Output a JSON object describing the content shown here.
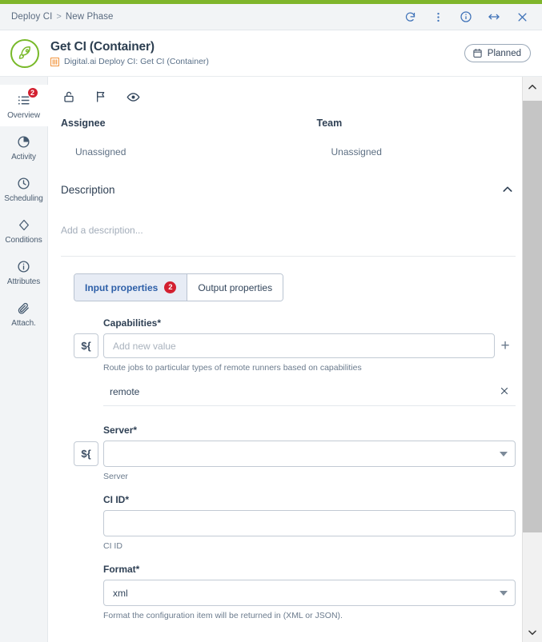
{
  "theme": {
    "accent_green": "#7fb52b",
    "badge_red": "#d32030",
    "link_blue": "#3f72b8",
    "tab_active_bg": "#e7ecf5",
    "tab_active_text": "#2d5fa8",
    "sidebar_bg": "#f2f4f6",
    "subtitle_icon_orange": "#f2953e"
  },
  "breadcrumb": {
    "root": "Deploy CI",
    "separator": ">",
    "current": "New Phase"
  },
  "window_actions": [
    {
      "name": "refresh-icon",
      "label": "Refresh"
    },
    {
      "name": "more-menu-icon",
      "label": "More options"
    },
    {
      "name": "info-icon",
      "label": "Info"
    },
    {
      "name": "expand-icon",
      "label": "Expand"
    },
    {
      "name": "close-icon",
      "label": "Close"
    }
  ],
  "header": {
    "logo_icon": "rocket-icon",
    "title": "Get CI (Container)",
    "subtitle_icon": "task-type-icon",
    "subtitle": "Digital.ai Deploy CI: Get CI (Container)",
    "status_icon": "calendar-icon",
    "status": "Planned"
  },
  "sidebar": {
    "items": [
      {
        "label": "Overview",
        "icon": "list-icon",
        "badge": "2",
        "active": true
      },
      {
        "label": "Activity",
        "icon": "pie-chart-icon",
        "badge": null,
        "active": false
      },
      {
        "label": "Scheduling",
        "icon": "clock-icon",
        "badge": null,
        "active": false
      },
      {
        "label": "Conditions",
        "icon": "diamond-icon",
        "badge": null,
        "active": false
      },
      {
        "label": "Attributes",
        "icon": "info-icon",
        "badge": null,
        "active": false
      },
      {
        "label": "Attach.",
        "icon": "paperclip-icon",
        "badge": null,
        "active": false
      }
    ]
  },
  "toolbar": [
    {
      "name": "unlock-icon",
      "label": "Unlock"
    },
    {
      "name": "flag-icon",
      "label": "Flag"
    },
    {
      "name": "eye-icon",
      "label": "Watch"
    }
  ],
  "assignment": {
    "assignee_label": "Assignee",
    "assignee_value": "Unassigned",
    "team_label": "Team",
    "team_value": "Unassigned"
  },
  "description": {
    "title": "Description",
    "collapse_icon": "chevron-up-icon",
    "placeholder": "Add a description..."
  },
  "tabs": [
    {
      "label": "Input properties",
      "badge": "2",
      "active": true
    },
    {
      "label": "Output properties",
      "badge": null,
      "active": false
    }
  ],
  "properties": {
    "capabilities": {
      "label": "Capabilities",
      "required": "*",
      "expr_button": "${",
      "input_value": "",
      "input_placeholder": "Add new value",
      "add_button": "+",
      "helper": "Route jobs to particular types of remote runners based on capabilities",
      "values": [
        {
          "text": "remote",
          "remove_icon": "close-icon"
        }
      ]
    },
    "server": {
      "label": "Server",
      "required": "*",
      "expr_button": "${",
      "selected": "",
      "helper": "Server"
    },
    "ci_id": {
      "label": "CI ID",
      "required": "*",
      "value": "",
      "helper": "CI ID"
    },
    "format": {
      "label": "Format",
      "required": "*",
      "selected": "xml",
      "helper": "Format the configuration item will be returned in (XML or JSON)."
    }
  },
  "scrollbar": {
    "up_icon": "chevron-up-icon",
    "down_icon": "chevron-down-icon"
  }
}
